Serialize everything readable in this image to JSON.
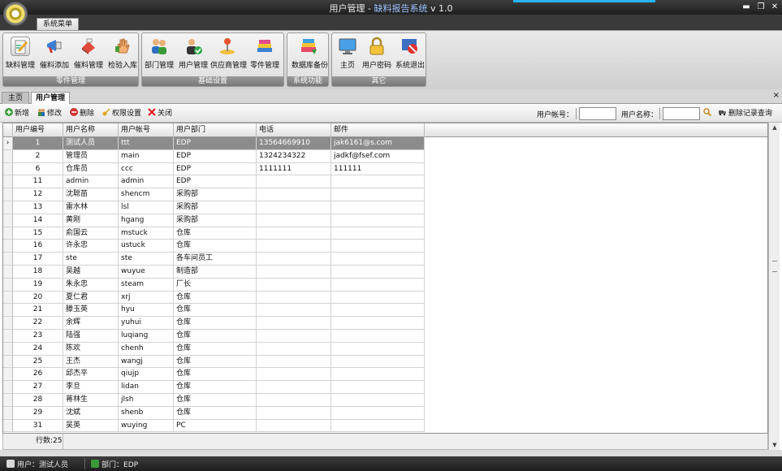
{
  "window": {
    "title": "用户管理",
    "separator": " - ",
    "app_name": "缺料报告系统",
    "version": "v 1.0",
    "controls": {
      "minimize": "▬",
      "restore": "❐",
      "close": "✕"
    }
  },
  "ribbon": {
    "tab_label": "系统菜单",
    "groups": [
      {
        "label": "零件管理",
        "buttons": [
          {
            "label": "缺料管理",
            "icon": "edit-doc-icon"
          },
          {
            "label": "催料添加",
            "icon": "megaphone-icon"
          },
          {
            "label": "催料管理",
            "icon": "eraser-icon"
          },
          {
            "label": "检验入库",
            "icon": "hand-icon"
          }
        ]
      },
      {
        "label": "基础设置",
        "buttons": [
          {
            "label": "部门管理",
            "icon": "group-icon"
          },
          {
            "label": "用户管理",
            "icon": "user-check-icon"
          },
          {
            "label": "供应商管理",
            "icon": "joystick-icon"
          },
          {
            "label": "零件管理",
            "icon": "parts-icon"
          }
        ]
      },
      {
        "label": "系统功能",
        "buttons": [
          {
            "label": "数据库备份",
            "icon": "database-backup-icon"
          }
        ]
      },
      {
        "label": "其它",
        "buttons": [
          {
            "label": "主页",
            "icon": "monitor-icon"
          },
          {
            "label": "用户密码",
            "icon": "lock-icon"
          },
          {
            "label": "系统退出",
            "icon": "exit-icon"
          }
        ]
      }
    ]
  },
  "doc_tabs": {
    "home": "主页",
    "users": "用户管理",
    "close": "×"
  },
  "toolbar": {
    "add": "新增",
    "edit": "修改",
    "delete": "删除",
    "permissions": "权限设置",
    "close": "关闭",
    "account_label": "用户帐号：",
    "account_value": "",
    "name_label": "用户名称：",
    "name_value": "",
    "search_text": "删除记录查询"
  },
  "grid": {
    "columns": [
      "用户编号",
      "用户名称",
      "用户帐号",
      "用户部门",
      "电话",
      "邮件"
    ],
    "selected_indicator": "›",
    "rows": [
      [
        "1",
        "测试人员",
        "ttt",
        "EDP",
        "13564669910",
        "jak6161@s.com"
      ],
      [
        "2",
        "管理员",
        "main",
        "EDP",
        "1324234322",
        "jadkf@fsef.com"
      ],
      [
        "6",
        "仓库员",
        "ccc",
        "EDP",
        "1111111",
        "111111"
      ],
      [
        "11",
        "admin",
        "admin",
        "EDP",
        "",
        ""
      ],
      [
        "12",
        "沈聪苗",
        "shencm",
        "采购部",
        "",
        ""
      ],
      [
        "13",
        "雷水林",
        "lsl",
        "采购部",
        "",
        ""
      ],
      [
        "14",
        "黄刚",
        "hgang",
        "采购部",
        "",
        ""
      ],
      [
        "15",
        "俞国云",
        "mstuck",
        "仓库",
        "",
        ""
      ],
      [
        "16",
        "许永忠",
        "ustuck",
        "仓库",
        "",
        ""
      ],
      [
        "17",
        "ste",
        "ste",
        "各车间员工",
        "",
        ""
      ],
      [
        "18",
        "吴越",
        "wuyue",
        "制造部",
        "",
        ""
      ],
      [
        "19",
        "朱永忠",
        "steam",
        "厂长",
        "",
        ""
      ],
      [
        "20",
        "夏仁君",
        "xrj",
        "仓库",
        "",
        ""
      ],
      [
        "21",
        "滕玉英",
        "hyu",
        "仓库",
        "",
        ""
      ],
      [
        "22",
        "余辉",
        "yuhui",
        "仓库",
        "",
        ""
      ],
      [
        "23",
        "陆强",
        "luqiang",
        "仓库",
        "",
        ""
      ],
      [
        "24",
        "陈欢",
        "chenh",
        "仓库",
        "",
        ""
      ],
      [
        "25",
        "王杰",
        "wangj",
        "仓库",
        "",
        ""
      ],
      [
        "26",
        "邱杰平",
        "qiujp",
        "仓库",
        "",
        ""
      ],
      [
        "27",
        "李旦",
        "lidan",
        "仓库",
        "",
        ""
      ],
      [
        "28",
        "蒋林生",
        "jlsh",
        "仓库",
        "",
        ""
      ],
      [
        "29",
        "沈斌",
        "shenb",
        "仓库",
        "",
        ""
      ],
      [
        "31",
        "吴英",
        "wuying",
        "PC",
        "",
        ""
      ]
    ],
    "row_count": "行数:25"
  },
  "status": {
    "user_label": "用户：",
    "user_value": "测试人员",
    "dept_label": "部门：",
    "dept_value": "EDP"
  },
  "colors": {
    "selected_row": "#8c8c8c",
    "app_name": "#9cc3ff",
    "accent_glow": "#28b4ff"
  }
}
